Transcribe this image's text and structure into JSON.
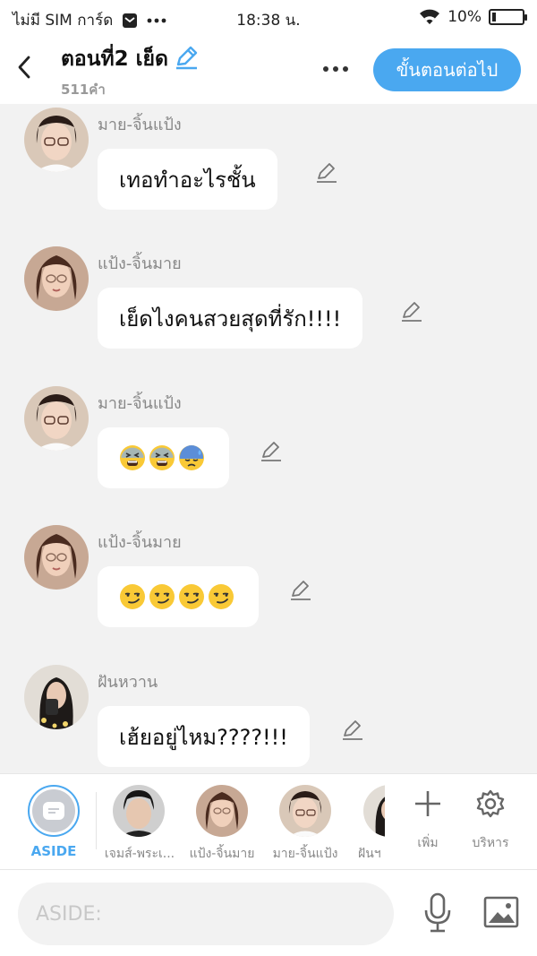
{
  "status_bar": {
    "carrier": "ไม่มี SIM การ์ด",
    "time": "18:38 น.",
    "battery": "10%",
    "battery_level": 0.1,
    "icons": [
      "notification-icon",
      "more-dots-icon",
      "wifi-icon",
      "battery-icon"
    ]
  },
  "header": {
    "title": "ตอนที่2 เย็ด",
    "word_count": "511คำ",
    "next_button": "ขั้นตอนต่อไป",
    "icons": [
      "back-arrow-icon",
      "pencil-icon",
      "more-icon"
    ]
  },
  "messages": [
    {
      "sender": "มาย-จิ้นแป้ง",
      "text": "เทอทำอะไรชั้น",
      "emojis": []
    },
    {
      "sender": "แป้ง-จิ้นมาย",
      "text": "เย็ดไงคนสวยสุดที่รัก!!!!",
      "emojis": []
    },
    {
      "sender": "มาย-จิ้นแป้ง",
      "text": "",
      "emojis": [
        "tired-face",
        "tired-face",
        "downcast-sweat-face"
      ]
    },
    {
      "sender": "แป้ง-จิ้นมาย",
      "text": "",
      "emojis": [
        "smirk-face",
        "smirk-face",
        "smirk-face",
        "smirk-face"
      ]
    },
    {
      "sender": "ฝันหวาน",
      "text": "เฮ้ยอยู่ไหม????!!!",
      "emojis": []
    }
  ],
  "characters_bar": {
    "aside_label": "ASIDE",
    "characters": [
      {
        "name": "เจมส์-พระเ..."
      },
      {
        "name": "แป้ง-จิ้นมาย"
      },
      {
        "name": "มาย-จิ้นแป้ง"
      },
      {
        "name": "ฝันฯ"
      }
    ],
    "add_label": "เพิ่ม",
    "manage_label": "บริหาร"
  },
  "input": {
    "placeholder": "ASIDE:",
    "value": ""
  },
  "colors": {
    "accent": "#4aa8f0",
    "background": "#f2f2f2",
    "bubble": "#ffffff",
    "muted_text": "#888888"
  }
}
